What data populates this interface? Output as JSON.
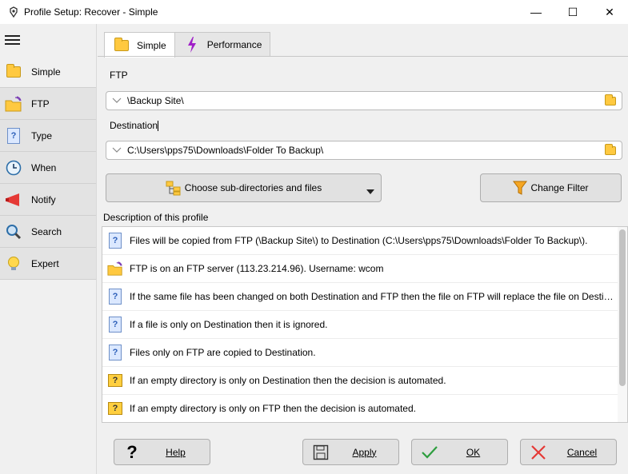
{
  "window": {
    "title": "Profile Setup: Recover - Simple",
    "minimize": "—",
    "maximize": "☐",
    "close": "✕"
  },
  "sidebar": {
    "items": [
      {
        "label": "Simple",
        "icon": "folder-icon"
      },
      {
        "label": "FTP",
        "icon": "ftp-folder-icon"
      },
      {
        "label": "Type",
        "icon": "question-doc-icon"
      },
      {
        "label": "When",
        "icon": "clock-icon"
      },
      {
        "label": "Notify",
        "icon": "megaphone-icon"
      },
      {
        "label": "Search",
        "icon": "magnifier-icon"
      },
      {
        "label": "Expert",
        "icon": "lightbulb-icon"
      }
    ]
  },
  "tabs": [
    {
      "label": "Simple",
      "icon": "folder-icon"
    },
    {
      "label": "Performance",
      "icon": "lightning-icon"
    }
  ],
  "ftp": {
    "label": "FTP",
    "value": "\\Backup Site\\"
  },
  "destination": {
    "label": "Destination",
    "value": "C:\\Users\\pps75\\Downloads\\Folder To Backup\\"
  },
  "buttons": {
    "choose_subdirs": "Choose sub-directories and files",
    "change_filter": "Change Filter"
  },
  "description": {
    "label": "Description of this profile",
    "rows": [
      {
        "icon": "question-doc-icon",
        "text": "Files will be copied from FTP (\\Backup Site\\) to Destination (C:\\Users\\pps75\\Downloads\\Folder To Backup\\)."
      },
      {
        "icon": "ftp-folder-icon",
        "text": "FTP is on an FTP server (113.23.214.96). Username: wcom"
      },
      {
        "icon": "question-doc-icon",
        "text": "If the same file has been changed on both Destination and FTP then the file on FTP will replace the file on Destinat..."
      },
      {
        "icon": "question-doc-icon",
        "text": "If a file is only on Destination then it is ignored."
      },
      {
        "icon": "question-doc-icon",
        "text": "Files only on FTP are copied to Destination."
      },
      {
        "icon": "question-folder-icon",
        "text": "If an empty directory is only on Destination then the decision is automated."
      },
      {
        "icon": "question-folder-icon",
        "text": "If an empty directory is only on FTP then the decision is automated."
      }
    ]
  },
  "footer": {
    "help": "Help",
    "apply": "Apply",
    "ok": "OK",
    "cancel": "Cancel"
  },
  "colors": {
    "accent_folder": "#ffc940",
    "ok_check": "#2e9e3f",
    "cancel_x": "#e53935",
    "filter_orange": "#f5a623",
    "lightning_purple": "#a020c8"
  }
}
